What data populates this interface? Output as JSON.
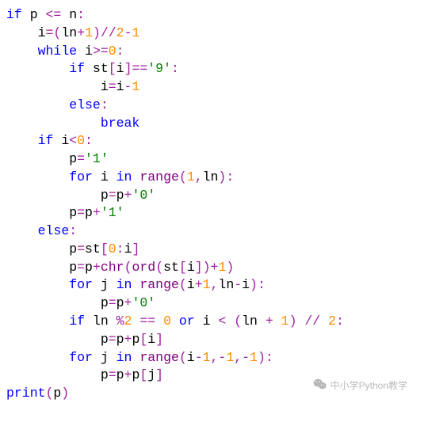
{
  "watermark": "中小学Python教学",
  "code": {
    "tokens": [
      [
        [
          "kw",
          "if"
        ],
        [
          "id",
          " p "
        ],
        [
          "op",
          "<="
        ],
        [
          "id",
          " n"
        ],
        [
          "op",
          ":"
        ]
      ],
      [
        [
          "id",
          "    i"
        ],
        [
          "op",
          "="
        ],
        [
          "op",
          "("
        ],
        [
          "id",
          "ln"
        ],
        [
          "op",
          "+"
        ],
        [
          "num",
          "1"
        ],
        [
          "op",
          ")"
        ],
        [
          "op",
          "//"
        ],
        [
          "num",
          "2"
        ],
        [
          "op",
          "-"
        ],
        [
          "num",
          "1"
        ]
      ],
      [
        [
          "id",
          "    "
        ],
        [
          "kw",
          "while"
        ],
        [
          "id",
          " i"
        ],
        [
          "op",
          ">="
        ],
        [
          "num",
          "0"
        ],
        [
          "op",
          ":"
        ]
      ],
      [
        [
          "id",
          "        "
        ],
        [
          "kw",
          "if"
        ],
        [
          "id",
          " st"
        ],
        [
          "op",
          "["
        ],
        [
          "id",
          "i"
        ],
        [
          "op",
          "]"
        ],
        [
          "op",
          "=="
        ],
        [
          "str",
          "'9'"
        ],
        [
          "op",
          ":"
        ]
      ],
      [
        [
          "id",
          "            i"
        ],
        [
          "op",
          "="
        ],
        [
          "id",
          "i"
        ],
        [
          "op",
          "-"
        ],
        [
          "num",
          "1"
        ]
      ],
      [
        [
          "id",
          "        "
        ],
        [
          "kw",
          "else"
        ],
        [
          "op",
          ":"
        ]
      ],
      [
        [
          "id",
          "            "
        ],
        [
          "kw",
          "break"
        ]
      ],
      [
        [
          "id",
          "    "
        ],
        [
          "kw",
          "if"
        ],
        [
          "id",
          " i"
        ],
        [
          "op",
          "<"
        ],
        [
          "num",
          "0"
        ],
        [
          "op",
          ":"
        ]
      ],
      [
        [
          "id",
          "        p"
        ],
        [
          "op",
          "="
        ],
        [
          "str",
          "'1'"
        ]
      ],
      [
        [
          "id",
          "        "
        ],
        [
          "kw",
          "for"
        ],
        [
          "id",
          " i "
        ],
        [
          "kw",
          "in"
        ],
        [
          "id",
          " "
        ],
        [
          "fn",
          "range"
        ],
        [
          "op",
          "("
        ],
        [
          "num",
          "1"
        ],
        [
          "op",
          ","
        ],
        [
          "id",
          "ln"
        ],
        [
          "op",
          ")"
        ],
        [
          "op",
          ":"
        ]
      ],
      [
        [
          "id",
          "            p"
        ],
        [
          "op",
          "="
        ],
        [
          "id",
          "p"
        ],
        [
          "op",
          "+"
        ],
        [
          "str",
          "'0'"
        ]
      ],
      [
        [
          "id",
          "        p"
        ],
        [
          "op",
          "="
        ],
        [
          "id",
          "p"
        ],
        [
          "op",
          "+"
        ],
        [
          "str",
          "'1'"
        ]
      ],
      [
        [
          "id",
          "    "
        ],
        [
          "kw",
          "else"
        ],
        [
          "op",
          ":"
        ]
      ],
      [
        [
          "id",
          "        p"
        ],
        [
          "op",
          "="
        ],
        [
          "id",
          "st"
        ],
        [
          "op",
          "["
        ],
        [
          "num",
          "0"
        ],
        [
          "op",
          ":"
        ],
        [
          "id",
          "i"
        ],
        [
          "op",
          "]"
        ]
      ],
      [
        [
          "id",
          "        p"
        ],
        [
          "op",
          "="
        ],
        [
          "id",
          "p"
        ],
        [
          "op",
          "+"
        ],
        [
          "fn",
          "chr"
        ],
        [
          "op",
          "("
        ],
        [
          "fn",
          "ord"
        ],
        [
          "op",
          "("
        ],
        [
          "id",
          "st"
        ],
        [
          "op",
          "["
        ],
        [
          "id",
          "i"
        ],
        [
          "op",
          "]"
        ],
        [
          "op",
          ")"
        ],
        [
          "op",
          "+"
        ],
        [
          "num",
          "1"
        ],
        [
          "op",
          ")"
        ]
      ],
      [
        [
          "id",
          "        "
        ],
        [
          "kw",
          "for"
        ],
        [
          "id",
          " j "
        ],
        [
          "kw",
          "in"
        ],
        [
          "id",
          " "
        ],
        [
          "fn",
          "range"
        ],
        [
          "op",
          "("
        ],
        [
          "id",
          "i"
        ],
        [
          "op",
          "+"
        ],
        [
          "num",
          "1"
        ],
        [
          "op",
          ","
        ],
        [
          "id",
          "ln"
        ],
        [
          "op",
          "-"
        ],
        [
          "id",
          "i"
        ],
        [
          "op",
          ")"
        ],
        [
          "op",
          ":"
        ]
      ],
      [
        [
          "id",
          "            p"
        ],
        [
          "op",
          "="
        ],
        [
          "id",
          "p"
        ],
        [
          "op",
          "+"
        ],
        [
          "str",
          "'0'"
        ]
      ],
      [
        [
          "id",
          "        "
        ],
        [
          "kw",
          "if"
        ],
        [
          "id",
          " ln "
        ],
        [
          "op",
          "%"
        ],
        [
          "num",
          "2"
        ],
        [
          "id",
          " "
        ],
        [
          "op",
          "=="
        ],
        [
          "id",
          " "
        ],
        [
          "num",
          "0"
        ],
        [
          "id",
          " "
        ],
        [
          "kw",
          "or"
        ],
        [
          "id",
          " i "
        ],
        [
          "op",
          "<"
        ],
        [
          "id",
          " "
        ],
        [
          "op",
          "("
        ],
        [
          "id",
          "ln "
        ],
        [
          "op",
          "+"
        ],
        [
          "id",
          " "
        ],
        [
          "num",
          "1"
        ],
        [
          "op",
          ")"
        ],
        [
          "id",
          " "
        ],
        [
          "op",
          "//"
        ],
        [
          "id",
          " "
        ],
        [
          "num",
          "2"
        ],
        [
          "op",
          ":"
        ]
      ],
      [
        [
          "id",
          "            p"
        ],
        [
          "op",
          "="
        ],
        [
          "id",
          "p"
        ],
        [
          "op",
          "+"
        ],
        [
          "id",
          "p"
        ],
        [
          "op",
          "["
        ],
        [
          "id",
          "i"
        ],
        [
          "op",
          "]"
        ]
      ],
      [
        [
          "id",
          "        "
        ],
        [
          "kw",
          "for"
        ],
        [
          "id",
          " j "
        ],
        [
          "kw",
          "in"
        ],
        [
          "id",
          " "
        ],
        [
          "fn",
          "range"
        ],
        [
          "op",
          "("
        ],
        [
          "id",
          "i"
        ],
        [
          "op",
          "-"
        ],
        [
          "num",
          "1"
        ],
        [
          "op",
          ","
        ],
        [
          "op",
          "-"
        ],
        [
          "num",
          "1"
        ],
        [
          "op",
          ","
        ],
        [
          "op",
          "-"
        ],
        [
          "num",
          "1"
        ],
        [
          "op",
          ")"
        ],
        [
          "op",
          ":"
        ]
      ],
      [
        [
          "id",
          "            p"
        ],
        [
          "op",
          "="
        ],
        [
          "id",
          "p"
        ],
        [
          "op",
          "+"
        ],
        [
          "id",
          "p"
        ],
        [
          "op",
          "["
        ],
        [
          "id",
          "j"
        ],
        [
          "op",
          "]"
        ]
      ],
      [
        [
          "kw",
          "print"
        ],
        [
          "op",
          "("
        ],
        [
          "id",
          "p"
        ],
        [
          "op",
          ")"
        ]
      ]
    ]
  }
}
